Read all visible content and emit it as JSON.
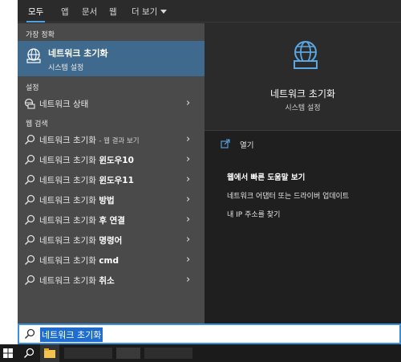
{
  "tabs": [
    {
      "label": "모두",
      "active": true
    },
    {
      "label": "앱",
      "active": false
    },
    {
      "label": "문서",
      "active": false
    },
    {
      "label": "웹",
      "active": false
    },
    {
      "label": "더 보기",
      "active": false
    }
  ],
  "sections": {
    "best_match": "가장 정확",
    "settings": "설정",
    "web_search": "웹 검색"
  },
  "best_match": {
    "title": "네트워크 초기화",
    "subtitle": "시스템 설정",
    "icon": "globe-network-icon"
  },
  "settings_items": [
    {
      "label": "네트워크 상태",
      "icon": "network-status-icon"
    }
  ],
  "web_results": [
    {
      "query": "네트워크 초기화",
      "suffix": "",
      "small": "- 웹 결과 보기"
    },
    {
      "query": "네트워크 초기화",
      "suffix": "윈도우10",
      "small": ""
    },
    {
      "query": "네트워크 초기화",
      "suffix": "윈도우11",
      "small": ""
    },
    {
      "query": "네트워크 초기화",
      "suffix": "방법",
      "small": ""
    },
    {
      "query": "네트워크 초기화",
      "suffix": "후 연결",
      "small": ""
    },
    {
      "query": "네트워크 초기화",
      "suffix": "명령어",
      "small": ""
    },
    {
      "query": "네트워크 초기화",
      "suffix": "cmd",
      "small": ""
    },
    {
      "query": "네트워크 초기화",
      "suffix": "취소",
      "small": ""
    }
  ],
  "detail": {
    "title": "네트워크 초기화",
    "subtitle": "시스템 설정",
    "open_label": "열기",
    "help_heading": "웹에서 빠른 도움말 보기",
    "help_links": [
      "네트워크 어댑터 또는 드라이버 업데이트",
      "내 IP 주소를 찾기"
    ]
  },
  "search": {
    "query": "네트워크 초기화"
  },
  "colors": {
    "accent": "#3f6a8e",
    "search_highlight": "#1f6ecf",
    "icon_blue": "#5aa7e6"
  }
}
